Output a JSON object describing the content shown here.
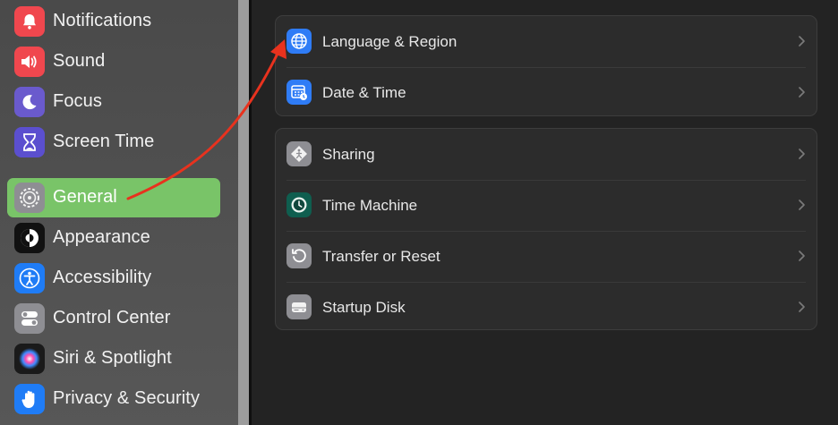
{
  "sidebar": {
    "items": [
      {
        "label": "Notifications",
        "icon": "bell-icon"
      },
      {
        "label": "Sound",
        "icon": "speaker-icon"
      },
      {
        "label": "Focus",
        "icon": "moon-icon"
      },
      {
        "label": "Screen Time",
        "icon": "hourglass-icon"
      },
      {
        "label": "General",
        "icon": "gear-icon",
        "selected": true
      },
      {
        "label": "Appearance",
        "icon": "appearance-icon"
      },
      {
        "label": "Accessibility",
        "icon": "accessibility-icon"
      },
      {
        "label": "Control Center",
        "icon": "toggles-icon"
      },
      {
        "label": "Siri & Spotlight",
        "icon": "siri-icon"
      },
      {
        "label": "Privacy & Security",
        "icon": "hand-icon"
      }
    ]
  },
  "main": {
    "group1": [
      {
        "label": "Language & Region",
        "icon": "globe-icon"
      },
      {
        "label": "Date & Time",
        "icon": "calendar-clock-icon"
      }
    ],
    "group2": [
      {
        "label": "Sharing",
        "icon": "sharing-icon"
      },
      {
        "label": "Time Machine",
        "icon": "time-machine-icon"
      },
      {
        "label": "Transfer or Reset",
        "icon": "reset-icon"
      },
      {
        "label": "Startup Disk",
        "icon": "disk-icon"
      }
    ]
  },
  "colors": {
    "selected_bg": "#79c468",
    "annotation_arrow": "#e8321e",
    "accent_blue": "#2f7cf6"
  }
}
